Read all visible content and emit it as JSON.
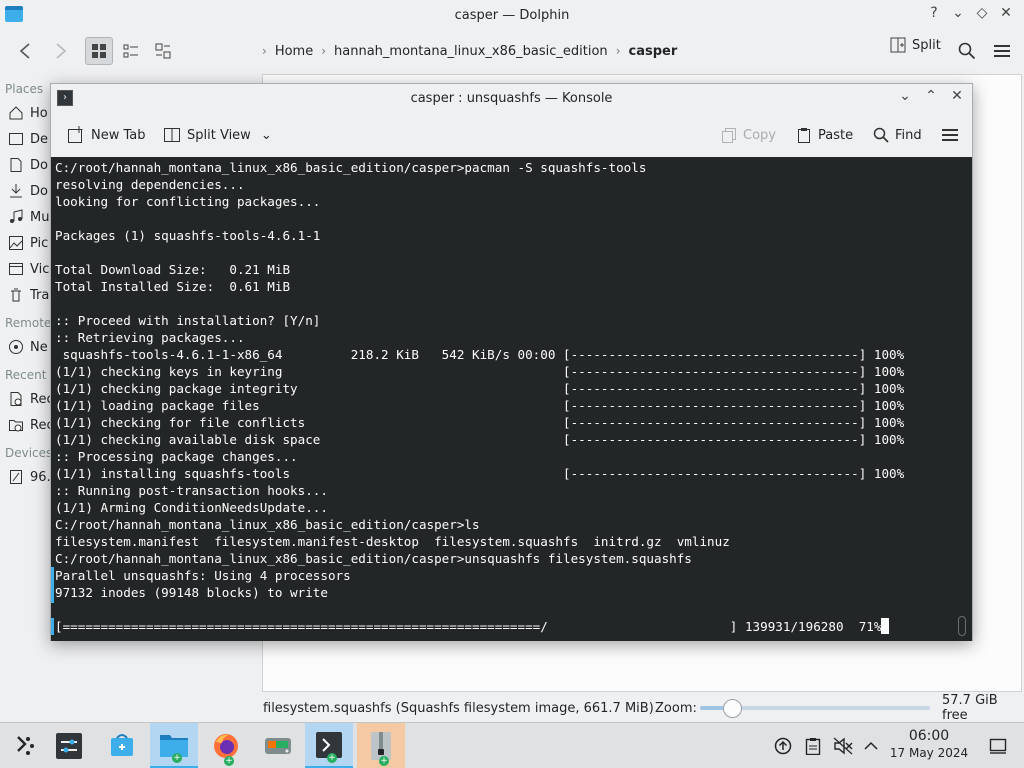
{
  "dolphin": {
    "title": "casper — Dolphin",
    "breadcrumb": [
      "Home",
      "hannah_montana_linux_x86_basic_edition",
      "casper"
    ],
    "split_label": "Split",
    "sidebar": {
      "places_header": "Places",
      "places": [
        {
          "label": "Ho",
          "icon": "home-icon"
        },
        {
          "label": "De",
          "icon": "desktop-icon"
        },
        {
          "label": "Do",
          "icon": "documents-icon"
        },
        {
          "label": "Do",
          "icon": "downloads-icon"
        },
        {
          "label": "Mu",
          "icon": "music-icon"
        },
        {
          "label": "Pic",
          "icon": "pictures-icon"
        },
        {
          "label": "Vic",
          "icon": "videos-icon"
        },
        {
          "label": "Tra",
          "icon": "trash-icon"
        }
      ],
      "remote_header": "Remote",
      "remote": [
        {
          "label": "Ne",
          "icon": "network-icon"
        }
      ],
      "recent_header": "Recent",
      "recent": [
        {
          "label": "Rec",
          "icon": "recent-files-icon"
        },
        {
          "label": "Rec",
          "icon": "recent-locations-icon"
        }
      ],
      "devices_header": "Devices",
      "devices": [
        {
          "label": "96.",
          "icon": "drive-icon"
        }
      ]
    },
    "status": {
      "selection": "filesystem.squashfs (Squashfs filesystem image, 661.7 MiB)",
      "zoom_label": "Zoom:",
      "zoom_level": 0.15,
      "free_space": "57.7 GiB free"
    }
  },
  "konsole": {
    "title": "casper : unsquashfs — Konsole",
    "toolbar": {
      "new_tab": "New Tab",
      "split_view": "Split View",
      "copy": "Copy",
      "paste": "Paste",
      "find": "Find"
    },
    "terminal_lines": [
      "C:/root/hannah_montana_linux_x86_basic_edition/casper>pacman -S squashfs-tools",
      "resolving dependencies...",
      "looking for conflicting packages...",
      "",
      "Packages (1) squashfs-tools-4.6.1-1",
      "",
      "Total Download Size:   0.21 MiB",
      "Total Installed Size:  0.61 MiB",
      "",
      ":: Proceed with installation? [Y/n]",
      ":: Retrieving packages...",
      " squashfs-tools-4.6.1-1-x86_64         218.2 KiB   542 KiB/s 00:00 [--------------------------------------] 100%",
      "(1/1) checking keys in keyring                                     [--------------------------------------] 100%",
      "(1/1) checking package integrity                                   [--------------------------------------] 100%",
      "(1/1) loading package files                                        [--------------------------------------] 100%",
      "(1/1) checking for file conflicts                                  [--------------------------------------] 100%",
      "(1/1) checking available disk space                                [--------------------------------------] 100%",
      ":: Processing package changes...",
      "(1/1) installing squashfs-tools                                    [--------------------------------------] 100%",
      ":: Running post-transaction hooks...",
      "(1/1) Arming ConditionNeedsUpdate...",
      "C:/root/hannah_montana_linux_x86_basic_edition/casper>ls",
      "filesystem.manifest  filesystem.manifest-desktop  filesystem.squashfs  initrd.gz  vmlinuz",
      "C:/root/hannah_montana_linux_x86_basic_edition/casper>unsquashfs filesystem.squashfs",
      "Parallel unsquashfs: Using 4 processors",
      "97132 inodes (99148 blocks) to write",
      "",
      "[===============================================================/                        ] 139931/196280  71%"
    ]
  },
  "taskbar": {
    "apps": [
      {
        "name": "application-launcher-icon"
      },
      {
        "name": "system-settings-icon"
      },
      {
        "name": "discover-icon"
      },
      {
        "name": "dolphin-icon"
      },
      {
        "name": "firefox-icon"
      },
      {
        "name": "disk-utility-icon"
      },
      {
        "name": "konsole-icon"
      },
      {
        "name": "archive-manager-icon"
      }
    ],
    "clock": {
      "time": "06:00",
      "date": "17 May 2024"
    }
  }
}
